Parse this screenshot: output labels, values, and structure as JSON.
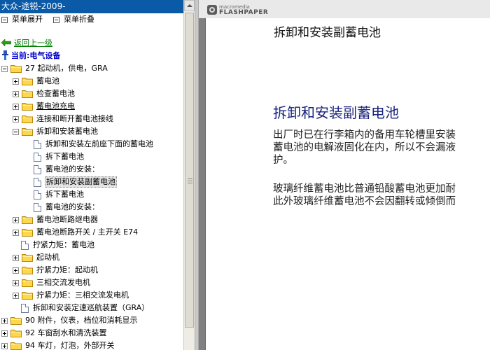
{
  "window": {
    "title": "大众-途锐-2009-"
  },
  "menu": {
    "expand_label": "菜单展开",
    "collapse_label": "菜单折叠"
  },
  "nav": {
    "back_label": "返回上一级",
    "current_label": "当前:电气设备"
  },
  "tree": [
    {
      "label": "27 起动机，供电，GRA",
      "type": "folder",
      "toggle": "minus",
      "level": 0
    },
    {
      "label": "蓄电池",
      "type": "folder",
      "toggle": "plus",
      "level": 1
    },
    {
      "label": "检查蓄电池",
      "type": "folder",
      "toggle": "plus",
      "level": 1
    },
    {
      "label": "蓄电池充电",
      "type": "folder",
      "toggle": "plus",
      "level": 1,
      "underline": true
    },
    {
      "label": "连接和断开蓄电池接线",
      "type": "folder",
      "toggle": "plus",
      "level": 1
    },
    {
      "label": "拆卸和安装蓄电池",
      "type": "folder",
      "toggle": "minus",
      "level": 1
    },
    {
      "label": "拆卸和安装左前座下面的蓄电池",
      "type": "doc",
      "level": 2
    },
    {
      "label": "拆下蓄电池",
      "type": "doc",
      "level": 2
    },
    {
      "label": "蓄电池的安装：",
      "type": "doc",
      "level": 2
    },
    {
      "label": "拆卸和安装副蓄电池",
      "type": "doc",
      "level": 2,
      "selected": true
    },
    {
      "label": "拆下蓄电池",
      "type": "doc",
      "level": 2
    },
    {
      "label": "蓄电池的安装：",
      "type": "doc",
      "level": 2
    },
    {
      "label": "蓄电池断路继电器",
      "type": "folder",
      "toggle": "plus",
      "level": 1
    },
    {
      "label": "蓄电池断路开关 / 主开关 E74",
      "type": "folder",
      "toggle": "plus",
      "level": 1
    },
    {
      "label": "拧紧力矩：蓄电池",
      "type": "doc",
      "level": 1
    },
    {
      "label": "起动机",
      "type": "folder",
      "toggle": "plus",
      "level": 1
    },
    {
      "label": "拧紧力矩：起动机",
      "type": "folder",
      "toggle": "plus",
      "level": 1
    },
    {
      "label": "三相交流发电机",
      "type": "folder",
      "toggle": "plus",
      "level": 1
    },
    {
      "label": "拧紧力矩：三相交流发电机",
      "type": "folder",
      "toggle": "plus",
      "level": 1
    },
    {
      "label": "拆卸和安装定速巡航装置（GRA）",
      "type": "doc",
      "level": 1
    },
    {
      "label": "90 附件，仪表，档位和消耗显示",
      "type": "folder",
      "toggle": "plus",
      "level": 0
    },
    {
      "label": "92 车窗刮水和清洗装置",
      "type": "folder",
      "toggle": "plus",
      "level": 0
    },
    {
      "label": "94 车灯，灯泡，外部开关",
      "type": "folder",
      "toggle": "plus",
      "level": 0
    }
  ],
  "viewer": {
    "logo_small": "macromedia",
    "logo_big": "FLASHPAPER",
    "page_header": "拆卸和安装副蓄电池",
    "doc_title": "拆卸和安装副蓄电池",
    "paragraph1": [
      "出厂时已在行李箱内的备用车轮槽里安装",
      "蓄电池的电解液固化在内，所以不会漏液",
      "护。"
    ],
    "paragraph2": [
      "玻璃纤维蓄电池比普通铅酸蓄电池更加耐",
      "此外玻璃纤维蓄电池不会因翻转或倾倒而"
    ]
  }
}
